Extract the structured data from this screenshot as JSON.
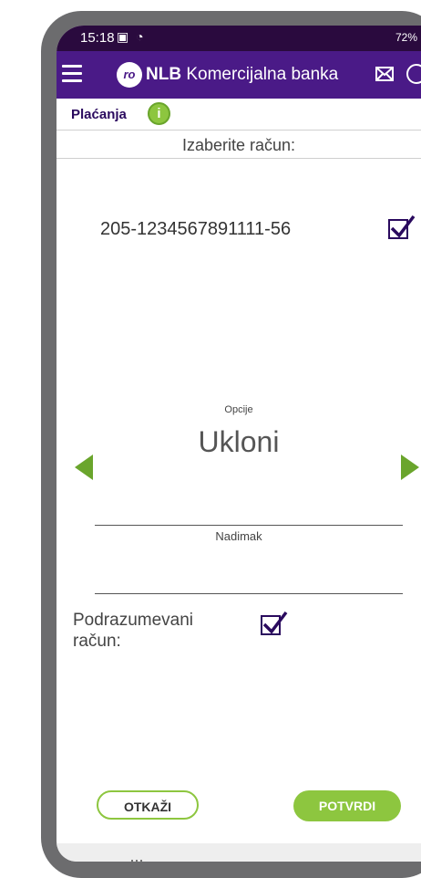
{
  "status_bar": {
    "time": "15:18",
    "right_text": "72%"
  },
  "app_bar": {
    "brand_bold": "NLB",
    "brand_rest": " Komercijalna banka",
    "logo_text": "ro"
  },
  "section": {
    "title": "Plaćanja",
    "info_glyph": "i"
  },
  "account_select": {
    "label": "Izaberite račun:",
    "account_number": "205-1234567891111-56",
    "checked": true
  },
  "options": {
    "label": "Opcije",
    "value": "Ukloni"
  },
  "nickname": {
    "label": "Nadimak",
    "value": ""
  },
  "default_account": {
    "label_line1": "Podrazumevani",
    "label_line2": "račun:",
    "checked": true
  },
  "buttons": {
    "cancel": "OTKAŽI",
    "confirm": "POTVRDI"
  },
  "colors": {
    "header": "#4a1a87",
    "status": "#2a0a3e",
    "accent_green": "#8dc63f",
    "check": "#2a0a5e"
  }
}
